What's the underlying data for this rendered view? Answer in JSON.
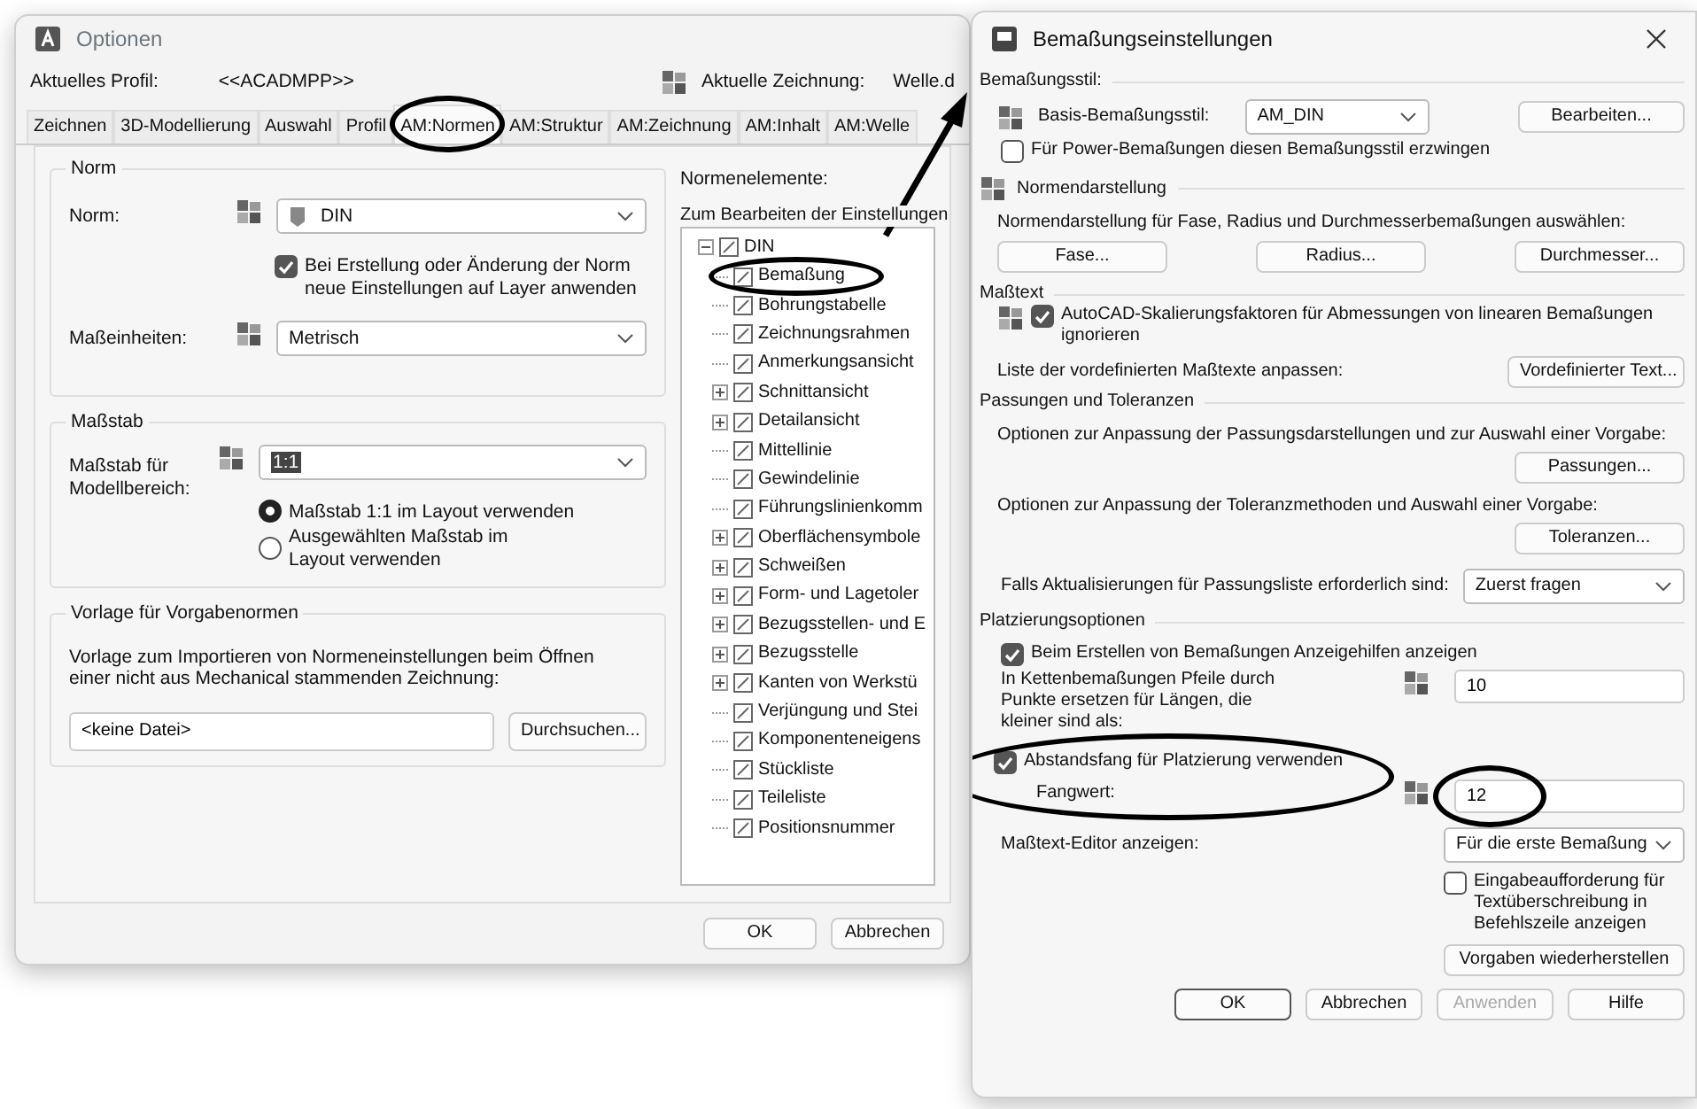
{
  "options_window": {
    "title": "Optionen",
    "profile_label": "Aktuelles Profil:",
    "profile_value": "<<ACADMPP>>",
    "drawing_label": "Aktuelle Zeichnung:",
    "drawing_value": "Welle.d",
    "tabs": [
      {
        "label": "Zeichnen",
        "selected": false,
        "circled": false
      },
      {
        "label": "3D-Modellierung",
        "selected": false,
        "circled": false
      },
      {
        "label": "Auswahl",
        "selected": false,
        "circled": false
      },
      {
        "label": "Profil",
        "selected": false,
        "circled": false
      },
      {
        "label": "AM:Normen",
        "selected": true,
        "circled": true
      },
      {
        "label": "AM:Struktur",
        "selected": false,
        "circled": false
      },
      {
        "label": "AM:Zeichnung",
        "selected": false,
        "circled": false
      },
      {
        "label": "AM:Inhalt",
        "selected": false,
        "circled": false
      },
      {
        "label": "AM:Welle",
        "selected": false,
        "circled": false
      }
    ],
    "norm_group": {
      "title": "Norm",
      "norm_label": "Norm:",
      "norm_value": "DIN",
      "layer_checkbox": {
        "label": "Bei Erstellung oder Änderung der Norm neue Einstellungen auf Layer anwenden",
        "checked": true
      },
      "units_label": "Maßeinheiten:",
      "units_value": "Metrisch"
    },
    "scale_group": {
      "title": "Maßstab",
      "scale_label": "Maßstab für Modellbereich:",
      "scale_value": "1:1",
      "options": [
        {
          "label": "Maßstab 1:1 im Layout verwenden",
          "selected": true
        },
        {
          "label": "Ausgewählten Maßstab im Layout verwenden",
          "selected": false
        }
      ]
    },
    "template_group": {
      "title": "Vorlage für Vorgabenormen",
      "description": "Vorlage zum Importieren von Normeneinstellungen beim Öffnen einer nicht aus Mechanical stammenden Zeichnung:",
      "file_value": "<keine Datei>",
      "browse_button": "Durchsuchen..."
    },
    "elements_label": "Normenelemente:",
    "tree_hint": "Zum Bearbeiten der Einstellungen",
    "tree": [
      {
        "label": "DIN",
        "expanded": true,
        "circled": false,
        "children": [
          {
            "label": "Bemaßung",
            "expandable": false,
            "circled": true
          },
          {
            "label": "Bohrungstabelle",
            "expandable": false,
            "circled": false
          },
          {
            "label": "Zeichnungsrahmen",
            "expandable": false,
            "circled": false
          },
          {
            "label": "Anmerkungsansicht",
            "expandable": false,
            "circled": false
          },
          {
            "label": "Schnittansicht",
            "expandable": true,
            "circled": false
          },
          {
            "label": "Detailansicht",
            "expandable": true,
            "circled": false
          },
          {
            "label": "Mittellinie",
            "expandable": false,
            "circled": false
          },
          {
            "label": "Gewindelinie",
            "expandable": false,
            "circled": false
          },
          {
            "label": "Führungslinienkomm",
            "expandable": false,
            "circled": false
          },
          {
            "label": "Oberflächensymbole",
            "expandable": true,
            "circled": false
          },
          {
            "label": "Schweißen",
            "expandable": true,
            "circled": false
          },
          {
            "label": "Form- und Lagetoler",
            "expandable": true,
            "circled": false
          },
          {
            "label": "Bezugsstellen- und E",
            "expandable": true,
            "circled": false
          },
          {
            "label": "Bezugsstelle",
            "expandable": true,
            "circled": false
          },
          {
            "label": "Kanten von Werkstü",
            "expandable": true,
            "circled": false
          },
          {
            "label": "Verjüngung und Stei",
            "expandable": false,
            "circled": false
          },
          {
            "label": "Komponenteneigens",
            "expandable": false,
            "circled": false
          },
          {
            "label": "Stückliste",
            "expandable": false,
            "circled": false
          },
          {
            "label": "Teileliste",
            "expandable": false,
            "circled": false
          },
          {
            "label": "Positionsnummer",
            "expandable": false,
            "circled": false
          }
        ]
      }
    ],
    "buttons": [
      "OK",
      "Abbrechen"
    ]
  },
  "dimension_dialog": {
    "title": "Bemaßungseinstellungen",
    "dim_style": {
      "heading": "Bemaßungsstil:",
      "label": "Basis-Bemaßungsstil:",
      "value": "AM_DIN",
      "edit_button": "Bearbeiten...",
      "force_checkbox": {
        "label": "Für Power-Bemaßungen diesen Bemaßungsstil erzwingen",
        "checked": false
      }
    },
    "standard_display": {
      "heading": "Normendarstellung",
      "description": "Normendarstellung für Fase, Radius und Durchmesserbemaßungen auswählen:",
      "buttons": [
        "Fase...",
        "Radius...",
        "Durchmesser..."
      ]
    },
    "dim_text": {
      "heading": "Maßtext",
      "ignore_checkbox": {
        "label": "AutoCAD-Skalierungsfaktoren für Abmessungen von linearen Bemaßungen ignorieren",
        "checked": true
      },
      "predefined_label": "Liste der vordefinierten Maßtexte anpassen:",
      "predefined_button": "Vordefinierter Text..."
    },
    "fits": {
      "heading": "Passungen und Toleranzen",
      "fit_text": "Optionen zur Anpassung der Passungsdarstellungen und zur Auswahl einer Vorgabe:",
      "fit_button": "Passungen...",
      "tol_text": "Optionen zur Anpassung der Toleranzmethoden und Auswahl einer Vorgabe:",
      "tol_button": "Toleranzen...",
      "update_label": "Falls Aktualisierungen für Passungsliste erforderlich sind:",
      "update_value": "Zuerst fragen"
    },
    "placement": {
      "heading": "Platzierungsoptionen",
      "helpers_checkbox": {
        "label": "Beim Erstellen von Bemaßungen Anzeigehilfen anzeigen",
        "checked": true
      },
      "chain_label": "In Kettenbemaßungen Pfeile durch Punkte ersetzen für Längen, die kleiner sind als:",
      "chain_value": "10",
      "snap_checkbox": {
        "label": "Abstandsfang für Platzierung verwenden",
        "checked": true
      },
      "snap_label": "Fangwert:",
      "snap_circled": true,
      "snap_value": "12",
      "snap_value_circled": true,
      "editor_label": "Maßtext-Editor anzeigen:",
      "editor_value": "Für die erste Bemaßung",
      "prompt_checkbox": {
        "label": "Eingabeaufforderung für Textüberschreibung in Befehlszeile anzeigen",
        "checked": false
      },
      "restore_button": "Vorgaben wiederherstellen"
    },
    "buttons": [
      {
        "label": "OK",
        "kind": "default",
        "disabled": false
      },
      {
        "label": "Abbrechen",
        "kind": "normal",
        "disabled": false
      },
      {
        "label": "Anwenden",
        "kind": "normal",
        "disabled": true
      },
      {
        "label": "Hilfe",
        "kind": "normal",
        "disabled": false
      }
    ]
  }
}
